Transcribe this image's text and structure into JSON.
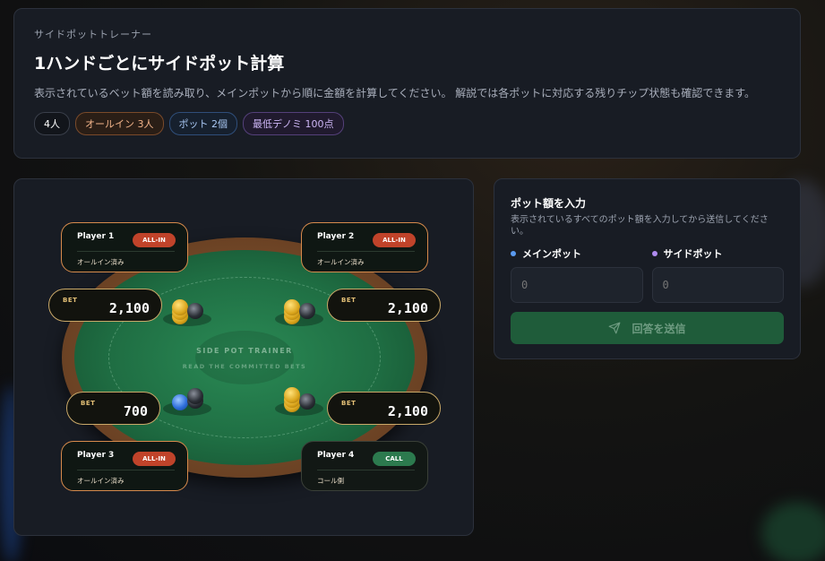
{
  "header": {
    "eyebrow": "サイドポットトレーナー",
    "title": "1ハンドごとにサイドポット計算",
    "description": "表示されているベット額を読み取り、メインポットから順に金額を計算してください。 解説では各ポットに対応する残りチップ状態も確認できます。",
    "chips": [
      "4人",
      "オールイン 3人",
      "ポット 2個",
      "最低デノミ 100点"
    ]
  },
  "table": {
    "brand_line1": "SIDE POT TRAINER",
    "brand_line2": "READ THE COMMITTED BETS",
    "players": [
      {
        "name": "Player 1",
        "badge": "ALL-IN",
        "status": "オールイン済み",
        "bet_label": "BET",
        "bet": "2,100"
      },
      {
        "name": "Player 2",
        "badge": "ALL-IN",
        "status": "オールイン済み",
        "bet_label": "BET",
        "bet": "2,100"
      },
      {
        "name": "Player 3",
        "badge": "ALL-IN",
        "status": "オールイン済み",
        "bet_label": "BET",
        "bet": "700"
      },
      {
        "name": "Player 4",
        "badge": "CALL",
        "status": "コール側",
        "bet_label": "BET",
        "bet": "2,100"
      }
    ]
  },
  "input": {
    "title": "ポット額を入力",
    "description": "表示されているすべてのポット額を入力してから送信してください。",
    "fields": [
      {
        "label": "メインポット",
        "placeholder": "0",
        "dot_color": "#5b9bf0"
      },
      {
        "label": "サイドポット",
        "placeholder": "0",
        "dot_color": "#b08cf0"
      }
    ],
    "submit_label": "回答を送信"
  }
}
